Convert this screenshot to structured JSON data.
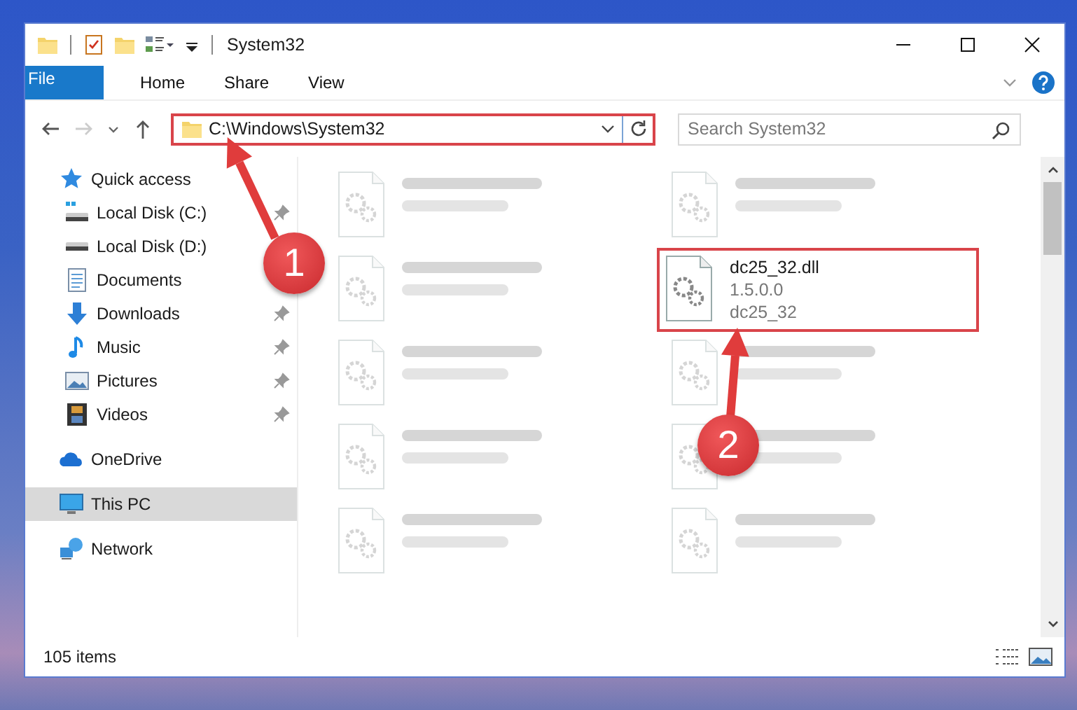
{
  "window": {
    "title": "System32"
  },
  "ribbon_tabs": [
    {
      "label": "File",
      "kind": "file"
    },
    {
      "label": "Home",
      "kind": "tab"
    },
    {
      "label": "Share",
      "kind": "tab"
    },
    {
      "label": "View",
      "kind": "tab"
    }
  ],
  "address_bar": {
    "path": "C:\\Windows\\System32",
    "highlighted": true
  },
  "search": {
    "placeholder": "Search System32"
  },
  "sidebar": {
    "items": [
      {
        "label": "Quick access",
        "kind": "star",
        "selected": false,
        "children": [
          {
            "label": "Local Disk (C:)",
            "kind": "disk-c",
            "pinned": true,
            "selected": false
          },
          {
            "label": "Local Disk (D:)",
            "kind": "disk",
            "pinned": false,
            "selected": false
          },
          {
            "label": "Documents",
            "kind": "documents",
            "pinned": false,
            "selected": false
          },
          {
            "label": "Downloads",
            "kind": "downloads",
            "pinned": true,
            "selected": false
          },
          {
            "label": "Music",
            "kind": "music",
            "pinned": true,
            "selected": false
          },
          {
            "label": "Pictures",
            "kind": "pictures",
            "pinned": true,
            "selected": false
          },
          {
            "label": "Videos",
            "kind": "videos",
            "pinned": true,
            "selected": false
          }
        ]
      },
      {
        "label": "OneDrive",
        "kind": "cloud",
        "selected": false
      },
      {
        "label": "This PC",
        "kind": "pc",
        "selected": true
      },
      {
        "label": "Network",
        "kind": "network",
        "selected": false
      }
    ]
  },
  "files": [
    {
      "kind": "blurred"
    },
    {
      "kind": "blurred"
    },
    {
      "kind": "blurred"
    },
    {
      "kind": "file",
      "name": "dc25_32.dll",
      "details": [
        "1.5.0.0",
        "dc25_32"
      ],
      "highlighted": true
    },
    {
      "kind": "blurred"
    },
    {
      "kind": "blurred"
    },
    {
      "kind": "blurred"
    },
    {
      "kind": "blurred"
    },
    {
      "kind": "blurred"
    },
    {
      "kind": "blurred"
    }
  ],
  "status_bar": {
    "item_count": "105 items"
  },
  "annotations": [
    {
      "number": "1"
    },
    {
      "number": "2"
    }
  ]
}
